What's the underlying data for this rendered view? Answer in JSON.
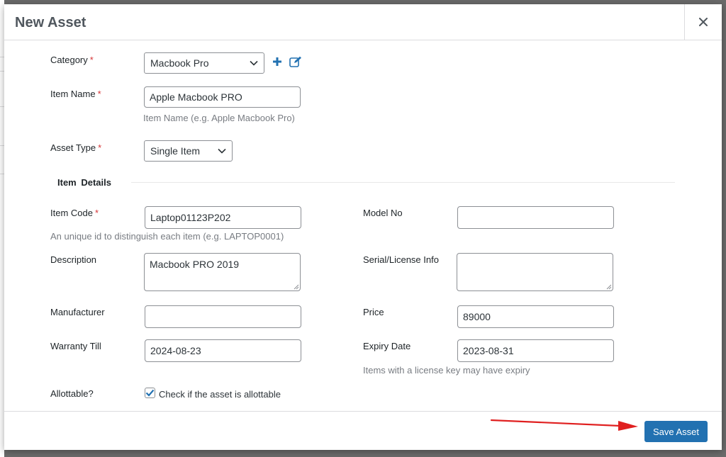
{
  "modal": {
    "title": "New Asset",
    "close_symbol": "×"
  },
  "form": {
    "category": {
      "label": "Category",
      "value": "Macbook Pro"
    },
    "item_name": {
      "label": "Item Name",
      "value": "Apple Macbook PRO",
      "help": "Item Name (e.g. Apple Macbook Pro)"
    },
    "asset_type": {
      "label": "Asset Type",
      "value": "Single Item"
    },
    "section_title": "Item Details",
    "item_code": {
      "label": "Item Code",
      "value": "Laptop01123P202",
      "help": "An unique id to distinguish each item (e.g. LAPTOP0001)"
    },
    "model_no": {
      "label": "Model No",
      "value": ""
    },
    "description": {
      "label": "Description",
      "value": "Macbook PRO 2019"
    },
    "serial_license": {
      "label": "Serial/License Info",
      "value": ""
    },
    "manufacturer": {
      "label": "Manufacturer",
      "value": ""
    },
    "price": {
      "label": "Price",
      "value": "89000"
    },
    "warranty_till": {
      "label": "Warranty Till",
      "value": "2024-08-23"
    },
    "expiry_date": {
      "label": "Expiry Date",
      "value": "2023-08-31",
      "help": "Items with a license key may have expiry"
    },
    "allottable": {
      "label": "Allottable?",
      "checkbox_label": "Check if the asset is allottable",
      "checked": true
    },
    "required_marker": "*"
  },
  "footer": {
    "save_label": "Save Asset"
  },
  "icons": {
    "add": "plus-icon",
    "edit": "edit-icon",
    "close": "close-icon",
    "dropdown": "chevron-down-icon",
    "check": "check-icon",
    "annotation": "arrow-annotation"
  },
  "colors": {
    "primary": "#2271b1",
    "required": "#d63638",
    "annotation_arrow": "#e02020"
  }
}
